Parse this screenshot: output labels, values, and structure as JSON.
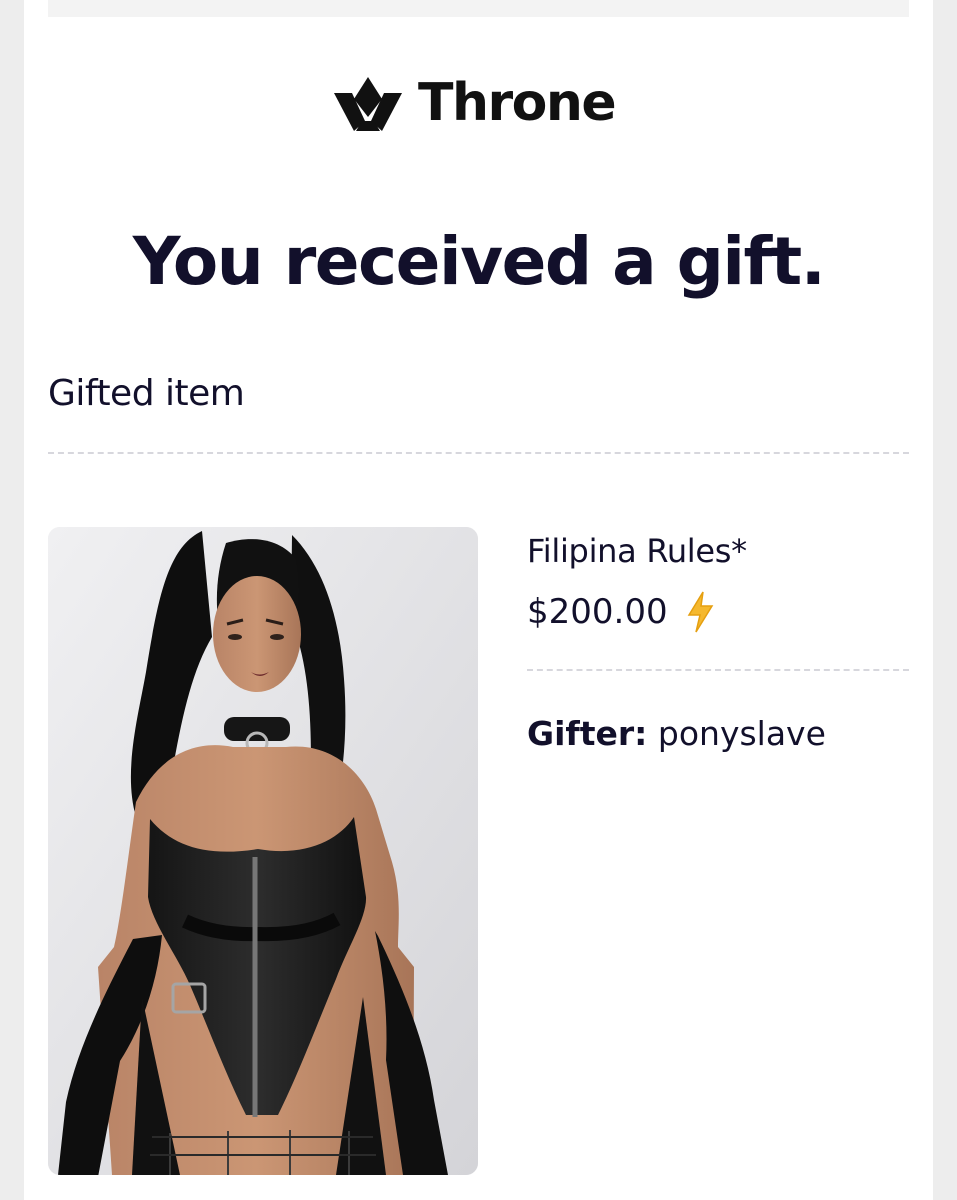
{
  "brand": {
    "name": "Throne",
    "icon": "crown-icon"
  },
  "headline": "You received a gift.",
  "section_label": "Gifted item",
  "item": {
    "image": "product-photo",
    "name": "Filipina Rules*",
    "price": "$200.00",
    "price_badge_icon": "lightning-bolt-icon"
  },
  "gifter": {
    "label": "Gifter:",
    "value": "ponyslave"
  },
  "colors": {
    "text_primary": "#12102b",
    "divider": "#d7d7dd",
    "bolt": "#f5b82e"
  }
}
